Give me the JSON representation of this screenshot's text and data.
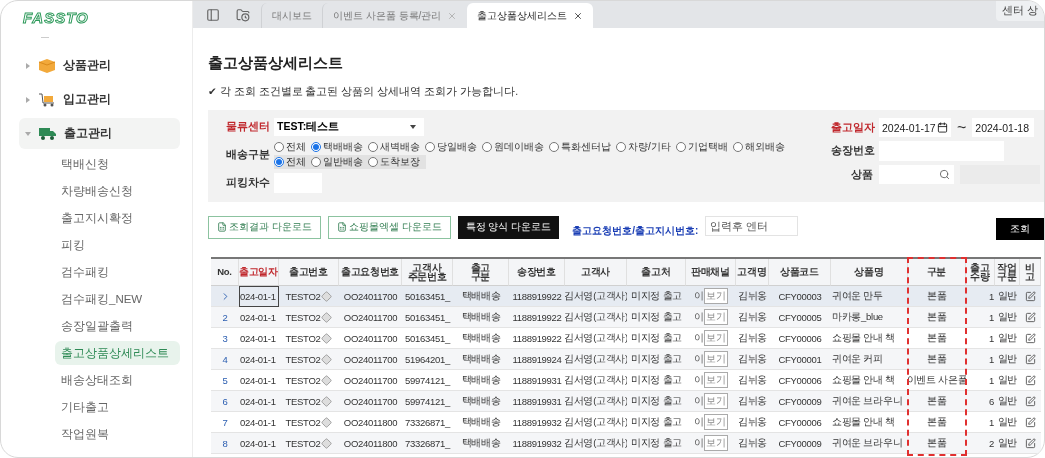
{
  "logo": "FASSTO",
  "sidebar": {
    "items": [
      {
        "label": "상품관리",
        "kind": "box",
        "expanded": false
      },
      {
        "label": "입고관리",
        "kind": "cart",
        "expanded": false
      },
      {
        "label": "출고관리",
        "kind": "truck",
        "expanded": true,
        "children": [
          {
            "label": "택배신청",
            "selected": false
          },
          {
            "label": "차량배송신청",
            "selected": false
          },
          {
            "label": "출고지시확정",
            "selected": false
          },
          {
            "label": "피킹",
            "selected": false
          },
          {
            "label": "검수패킹",
            "selected": false
          },
          {
            "label": "검수패킹_NEW",
            "selected": false
          },
          {
            "label": "송장일괄출력",
            "selected": false
          },
          {
            "label": "출고상품상세리스트",
            "selected": true
          },
          {
            "label": "배송상태조회",
            "selected": false
          },
          {
            "label": "기타출고",
            "selected": false
          },
          {
            "label": "작업원복",
            "selected": false
          }
        ]
      }
    ]
  },
  "tabs": [
    {
      "label": "대시보드",
      "closable": false,
      "selected": false
    },
    {
      "label": "이벤트 사은품 등록/관리",
      "closable": true,
      "selected": false
    },
    {
      "label": "출고상품상세리스트",
      "closable": true,
      "selected": true
    }
  ],
  "top_right_button": "센터 상",
  "page": {
    "title": "출고상품상세리스트",
    "note": "✔ 각 조회 조건별로 출고된 상품의 상세내역 조회가 가능합니다."
  },
  "filters": {
    "center": {
      "label": "물류센터",
      "value": "TEST:테스트"
    },
    "delivery": {
      "label": "배송구분",
      "options": [
        {
          "label": "전체",
          "selected": false
        },
        {
          "label": "택배배송",
          "selected": true
        },
        {
          "label": "새벽배송",
          "selected": false
        },
        {
          "label": "당일배송",
          "selected": false
        },
        {
          "label": "원데이배송",
          "selected": false
        },
        {
          "label": "특화센터납",
          "selected": false
        },
        {
          "label": "차량/기타",
          "selected": false
        },
        {
          "label": "기업택배",
          "selected": false
        },
        {
          "label": "해외배송",
          "selected": false
        }
      ],
      "sub_options": [
        {
          "label": "전체",
          "selected": true
        },
        {
          "label": "일반배송",
          "selected": false
        },
        {
          "label": "도착보장",
          "selected": false
        }
      ]
    },
    "picking": {
      "label": "피킹차수"
    },
    "date": {
      "label": "출고일자",
      "from": "2024-01-17",
      "separator": "~",
      "to": "2024-01-18"
    },
    "invoice": {
      "label": "송장번호"
    },
    "product": {
      "label": "상품"
    }
  },
  "actions": {
    "buttons": [
      {
        "label": "조회결과 다운로드",
        "kind": "excel"
      },
      {
        "label": "쇼핑몰엑셀 다운로드",
        "kind": "excel"
      },
      {
        "label": "특정 양식 다운로드",
        "kind": "dark"
      }
    ],
    "lookup_label": "출고요청번호/출고지시번호:",
    "lookup_placeholder": "입력후 엔터",
    "search_button": "조회"
  },
  "table": {
    "columns": [
      {
        "label": "No.",
        "kind": "no",
        "emphasis": false,
        "highlighted": false
      },
      {
        "label": "출고일자",
        "kind": "date",
        "emphasis": true,
        "highlighted": false
      },
      {
        "label": "출고번호",
        "kind": "out_no",
        "emphasis": false,
        "highlighted": false
      },
      {
        "label": "출고요청번호",
        "kind": "request_no",
        "emphasis": false,
        "highlighted": false
      },
      {
        "label": "고객사\n주문번호",
        "kind": "order_no",
        "emphasis": false,
        "highlighted": false
      },
      {
        "label": "출고\n구분",
        "kind": "out_type",
        "emphasis": false,
        "highlighted": false
      },
      {
        "label": "송장번호",
        "kind": "invoice",
        "emphasis": false,
        "highlighted": false
      },
      {
        "label": "고객사",
        "kind": "customer",
        "emphasis": false,
        "highlighted": false
      },
      {
        "label": "출고처",
        "kind": "destination",
        "emphasis": false,
        "highlighted": false
      },
      {
        "label": "판매채널",
        "kind": "channel",
        "emphasis": false,
        "highlighted": false
      },
      {
        "label": "고객명",
        "kind": "recipient",
        "emphasis": false,
        "highlighted": false
      },
      {
        "label": "상품코드",
        "kind": "product_code",
        "emphasis": false,
        "highlighted": false
      },
      {
        "label": "상품명",
        "kind": "product_name",
        "emphasis": false,
        "highlighted": false
      },
      {
        "label": "구분",
        "kind": "category",
        "emphasis": false,
        "highlighted": true
      },
      {
        "label": "출고\n수량",
        "kind": "qty",
        "emphasis": false,
        "highlighted": false
      },
      {
        "label": "작업\n구분",
        "kind": "work_type",
        "emphasis": false,
        "highlighted": false
      },
      {
        "label": "비\n고",
        "kind": "edit",
        "emphasis": false,
        "highlighted": false
      }
    ],
    "rows": [
      {
        "selected": true,
        "date": "024-01-1",
        "out_no": "TESTO2",
        "request_no": "OO24011700",
        "order_no": "50163451_",
        "out_type": "택배배송",
        "invoice": "1188919922",
        "customer": "김서영(고객사)",
        "destination": "미지정 출고",
        "channel": "이",
        "channel_button": "보기",
        "recipient": "김뉘옹",
        "product_code": "CFY00003",
        "product_name": "귀여운 만두",
        "category": "본품",
        "qty": "1",
        "work_type": "일반"
      },
      {
        "selected": false,
        "no": "2",
        "date": "024-01-1",
        "out_no": "TESTO2",
        "request_no": "OO24011700",
        "order_no": "50163451_",
        "out_type": "택배배송",
        "invoice": "1188919922",
        "customer": "김서영(고객사)",
        "destination": "미지정 출고",
        "channel": "이",
        "channel_button": "보기",
        "recipient": "김뉘옹",
        "product_code": "CFY00005",
        "product_name": "마카롱_blue",
        "category": "본품",
        "qty": "1",
        "work_type": "일반"
      },
      {
        "selected": false,
        "no": "3",
        "date": "024-01-1",
        "out_no": "TESTO2",
        "request_no": "OO24011700",
        "order_no": "50163451_",
        "out_type": "택배배송",
        "invoice": "1188919922",
        "customer": "김서영(고객사)",
        "destination": "미지정 출고",
        "channel": "이",
        "channel_button": "보기",
        "recipient": "김뉘옹",
        "product_code": "CFY00006",
        "product_name": "쇼핑몰 안내 책",
        "category": "본품",
        "qty": "1",
        "work_type": "일반"
      },
      {
        "selected": false,
        "no": "4",
        "date": "024-01-1",
        "out_no": "TESTO2",
        "request_no": "OO24011700",
        "order_no": "51964201_",
        "out_type": "택배배송",
        "invoice": "1188919924",
        "customer": "김서영(고객사)",
        "destination": "미지정 출고",
        "channel": "이",
        "channel_button": "보기",
        "recipient": "김뉘옹",
        "product_code": "CFY00001",
        "product_name": "귀여운 커피",
        "category": "본품",
        "qty": "1",
        "work_type": "일반"
      },
      {
        "selected": false,
        "no": "5",
        "date": "024-01-1",
        "out_no": "TESTO2",
        "request_no": "OO24011700",
        "order_no": "59974121_",
        "out_type": "택배배송",
        "invoice": "1188919931",
        "customer": "김서영(고객사)",
        "destination": "미지정 출고",
        "channel": "이",
        "channel_button": "보기",
        "recipient": "김뉘옹",
        "product_code": "CFY00006",
        "product_name": "쇼핑몰 안내 책",
        "category": "이벤트 사은품",
        "qty": "1",
        "work_type": "일반"
      },
      {
        "selected": false,
        "no": "6",
        "date": "024-01-1",
        "out_no": "TESTO2",
        "request_no": "OO24011700",
        "order_no": "59974121_",
        "out_type": "택배배송",
        "invoice": "1188919931",
        "customer": "김서영(고객사)",
        "destination": "미지정 출고",
        "channel": "이",
        "channel_button": "보기",
        "recipient": "김뉘옹",
        "product_code": "CFY00009",
        "product_name": "귀여운 브라우니",
        "category": "본품",
        "qty": "6",
        "work_type": "일반"
      },
      {
        "selected": false,
        "no": "7",
        "date": "024-01-1",
        "out_no": "TESTO2",
        "request_no": "OO24011800",
        "order_no": "73326871_",
        "out_type": "택배배송",
        "invoice": "1188919932",
        "customer": "김서영(고객사)",
        "destination": "미지정 출고",
        "channel": "이",
        "channel_button": "보기",
        "recipient": "김뉘옹",
        "product_code": "CFY00006",
        "product_name": "쇼핑몰 안내 책",
        "category": "본품",
        "qty": "1",
        "work_type": "일반"
      },
      {
        "selected": false,
        "no": "8",
        "date": "024-01-1",
        "out_no": "TESTO2",
        "request_no": "OO24011800",
        "order_no": "73326871_",
        "out_type": "택배배송",
        "invoice": "1188919932",
        "customer": "김서영(고객사)",
        "destination": "미지정 출고",
        "channel": "이",
        "channel_button": "보기",
        "recipient": "김뉘옹",
        "product_code": "CFY00009",
        "product_name": "귀여운 브라우니",
        "category": "본품",
        "qty": "2",
        "work_type": "일반"
      }
    ]
  }
}
